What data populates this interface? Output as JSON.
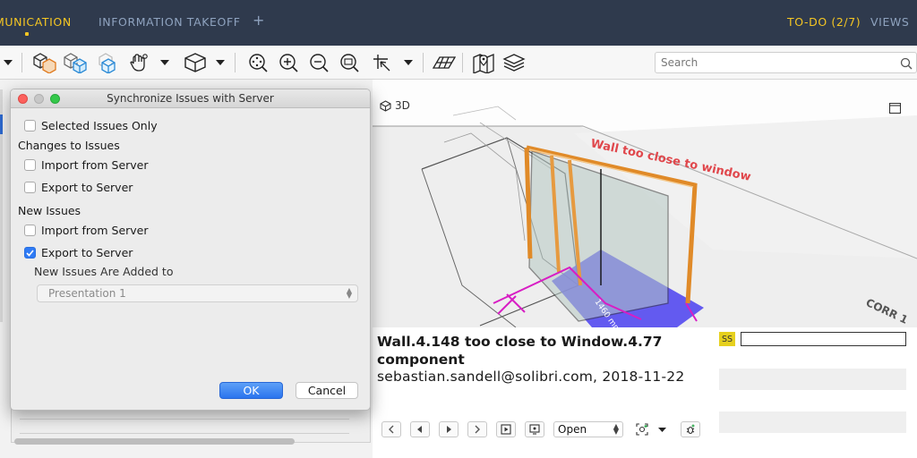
{
  "topnav": {
    "tabs": [
      {
        "label": "MUNICATION",
        "active": true
      },
      {
        "label": "INFORMATION TAKEOFF",
        "active": false
      }
    ],
    "add_tab_icon": "plus",
    "todo_label": "TO-DO (2/7)",
    "views_label": "VIEWS",
    "colors": {
      "bg": "#2f3a4d",
      "accent": "#f5c623",
      "inactive": "#8fa3bf"
    }
  },
  "toolbar": {
    "icons": [
      "dropdown-arrow-icon",
      "color-by-cubes-icon",
      "transparent-cubes-icon",
      "cube-outline-icon",
      "hand-grab-icon",
      "dropdown-arrow-icon",
      "box-icon",
      "dropdown-arrow-icon",
      "zoom-fit-icon",
      "zoom-in-icon",
      "zoom-out-icon",
      "zoom-window-icon",
      "select-cursor-icon",
      "dropdown-arrow-icon",
      "grid-plane-icon",
      "map-pin-icon",
      "layers-icon"
    ],
    "search_placeholder": "Search"
  },
  "view3d": {
    "title": "3D",
    "annotation": "Wall too close to window",
    "dimension_label": "1460 mm",
    "corner_label": "CORR 1"
  },
  "dialog": {
    "title": "Synchronize Issues with Server",
    "selected_only": {
      "label": "Selected Issues Only",
      "checked": false
    },
    "changes_group": "Changes to Issues",
    "changes_import": {
      "label": "Import from Server",
      "checked": false
    },
    "changes_export": {
      "label": "Export to Server",
      "checked": false
    },
    "new_group": "New Issues",
    "new_import": {
      "label": "Import from Server",
      "checked": false
    },
    "new_export": {
      "label": "Export to Server",
      "checked": true
    },
    "added_to_label": "New Issues Are Added to",
    "added_to_value": "Presentation 1",
    "ok_label": "OK",
    "cancel_label": "Cancel",
    "accent": "#2f7bf5"
  },
  "issue": {
    "title": "Wall.4.148 too close to Window.4.77 component",
    "author_line": "sebastian.sandell@solibri.com, 2018-11-22",
    "badge": "SS",
    "status_value": "Open",
    "nav_icons": [
      "chevron-left-icon",
      "triangle-left-icon",
      "triangle-right-icon",
      "chevron-right-icon",
      "play-slide-icon",
      "presentation-icon"
    ],
    "extra_icons": [
      "add-viewpoint-icon",
      "dropdown-arrow-icon",
      "bug-add-icon"
    ]
  }
}
